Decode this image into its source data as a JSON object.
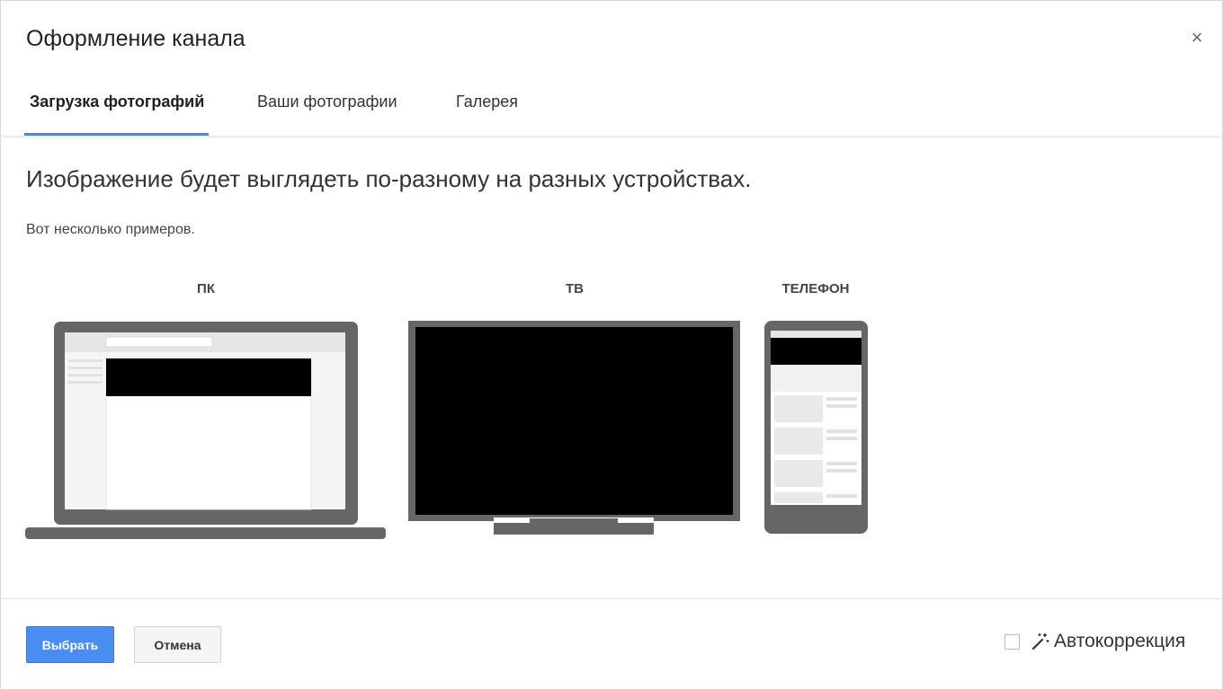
{
  "dialog": {
    "title": "Оформление канала",
    "close_label": "×"
  },
  "tabs": [
    {
      "label": "Загрузка фотографий",
      "active": true
    },
    {
      "label": "Ваши фотографии",
      "active": false
    },
    {
      "label": "Галерея",
      "active": false
    }
  ],
  "content": {
    "headline": "Изображение будет выглядеть по-разному на разных устройствах.",
    "subtext": "Вот несколько примеров."
  },
  "devices": {
    "pc_label": "ПК",
    "tv_label": "ТВ",
    "phone_label": "ТЕЛЕФОН"
  },
  "footer": {
    "select_label": "Выбрать",
    "cancel_label": "Отмена",
    "autocorrect_label": "Автокоррекция",
    "autocorrect_checked": false
  },
  "colors": {
    "accent": "#4a8df0",
    "tab_underline": "#4e88d9",
    "device_frame": "#666666",
    "banner": "#000000"
  }
}
